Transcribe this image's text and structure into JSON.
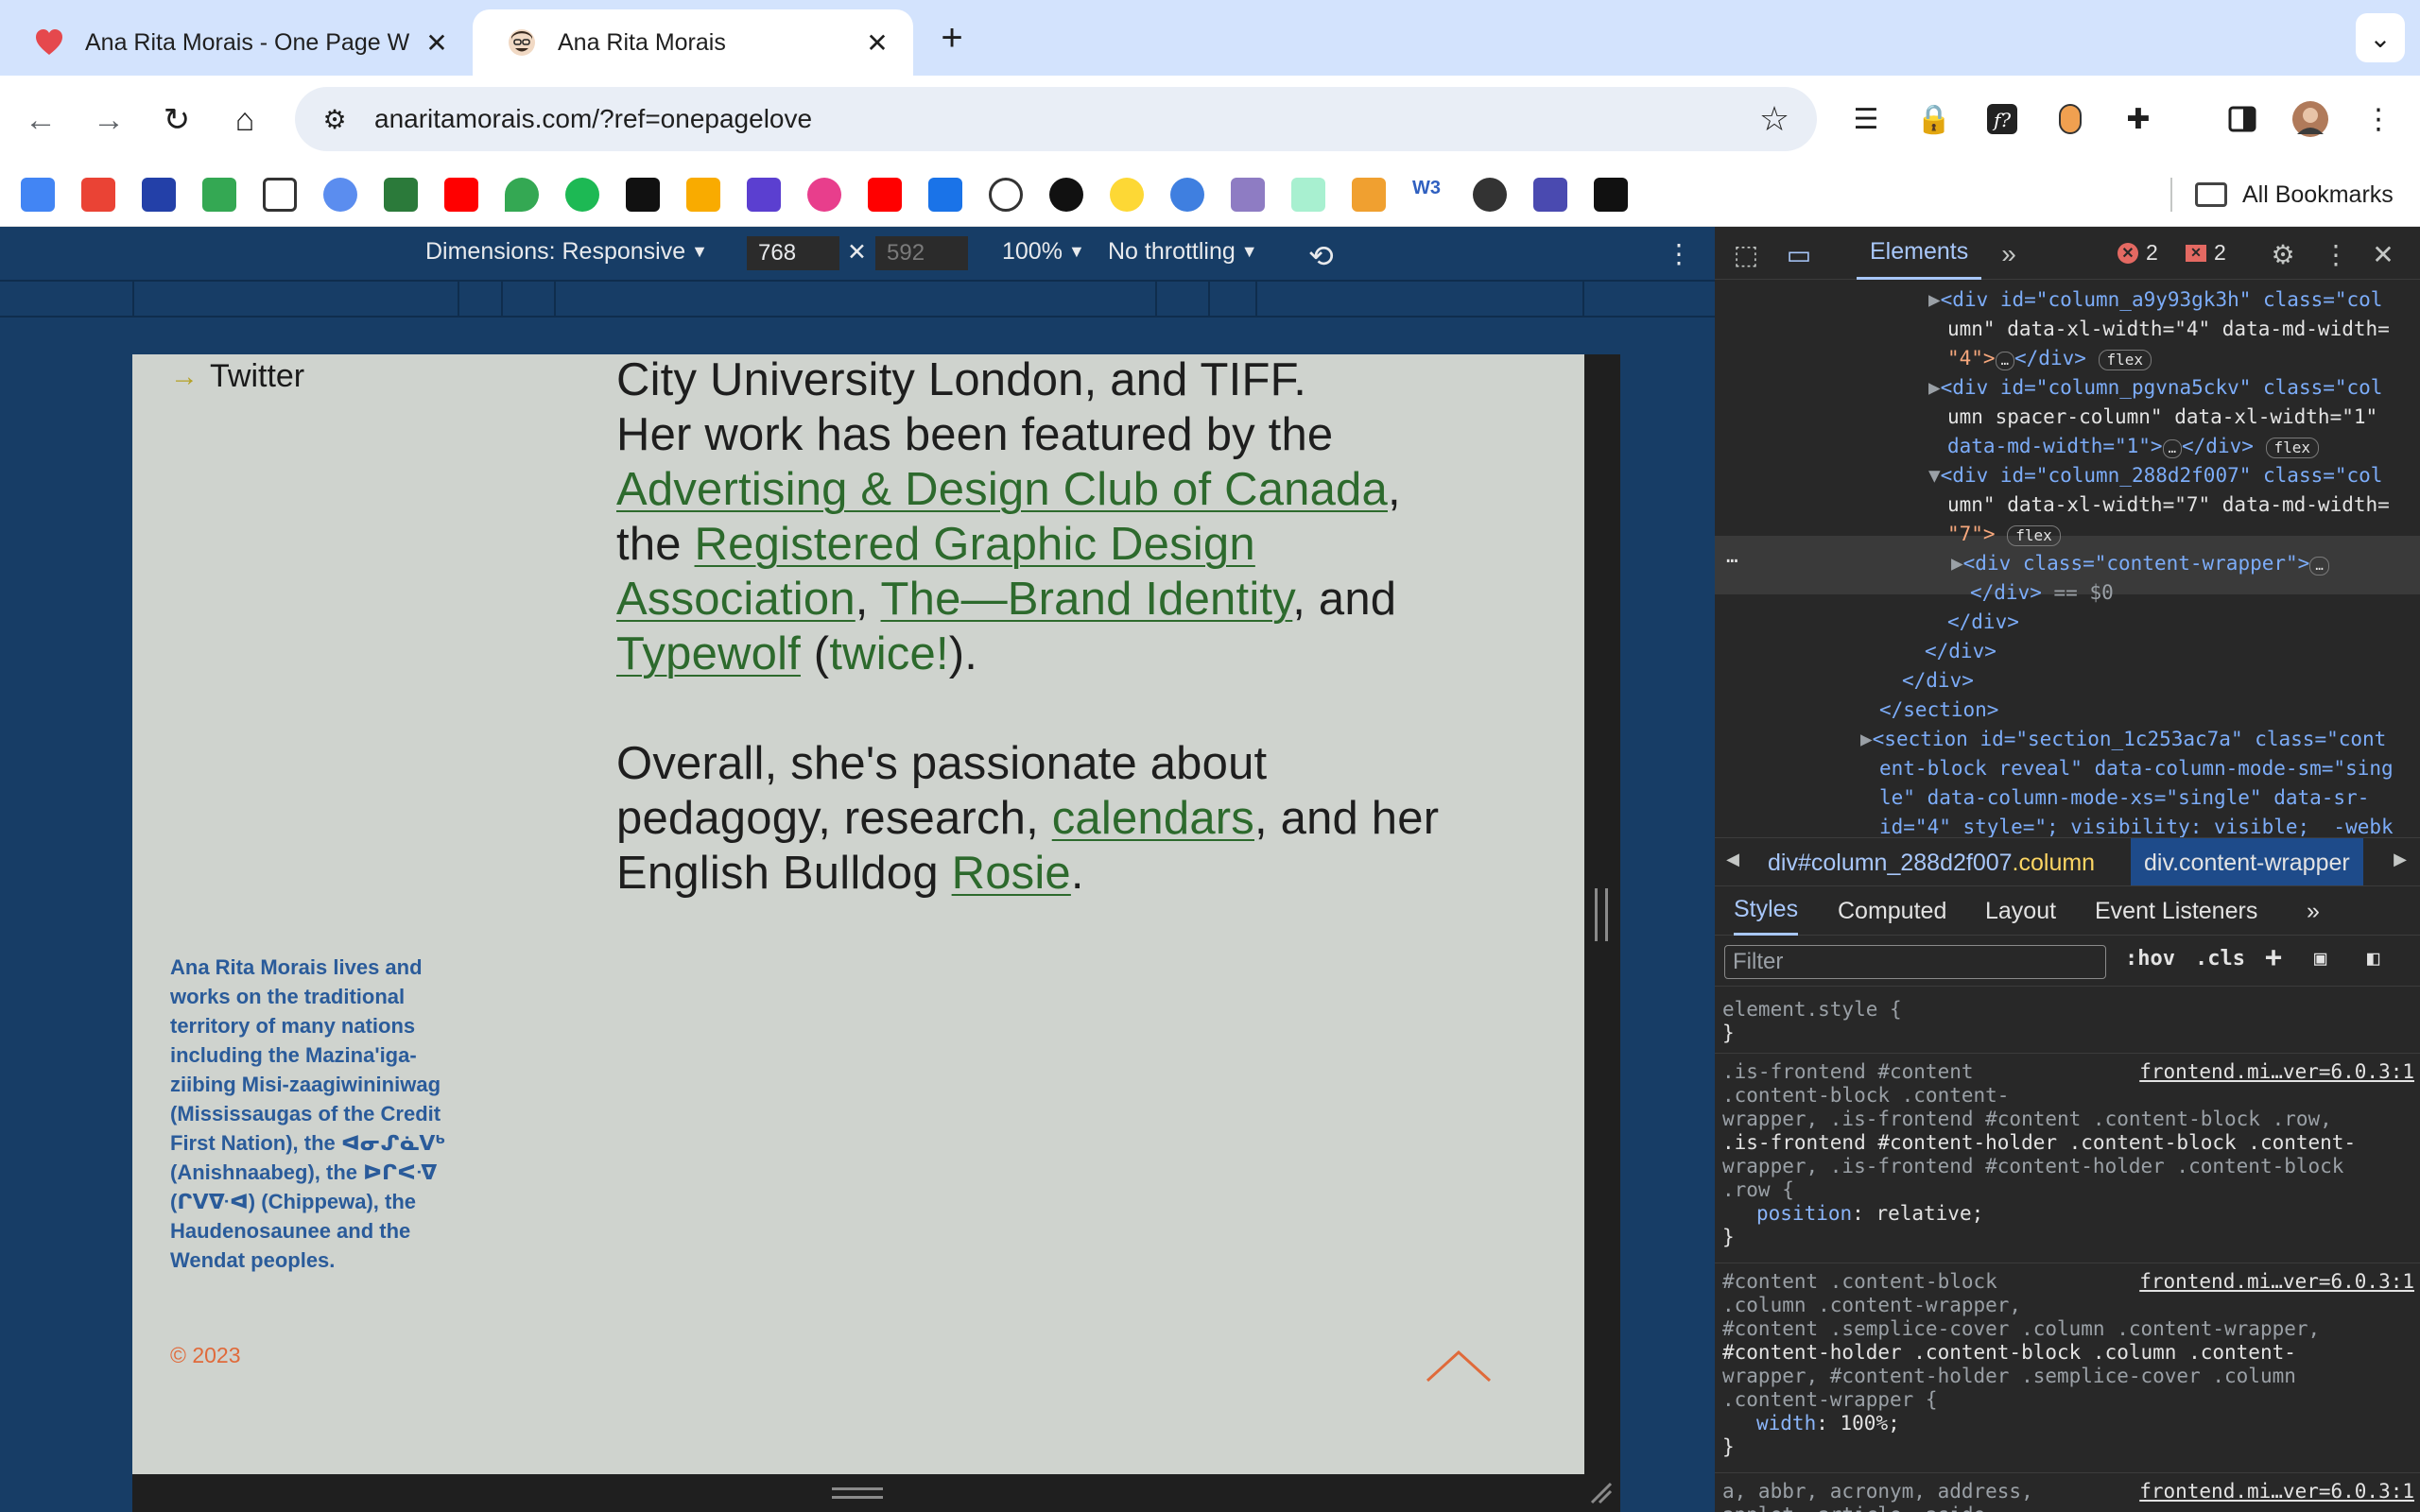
{
  "tabs": [
    {
      "title": "Ana Rita Morais - One Page W",
      "icon": "heart-icon"
    },
    {
      "title": "Ana Rita Morais",
      "icon": "avatar-icon"
    }
  ],
  "address": {
    "url": "anaritamorais.com/?ref=onepagelove"
  },
  "bookmarks": {
    "all_label": "All Bookmarks"
  },
  "device_toolbar": {
    "dimensions_label": "Dimensions: Responsive",
    "width": "768",
    "height": "592",
    "zoom": "100%",
    "throttling": "No throttling"
  },
  "page": {
    "nav_link": "Twitter",
    "bio_line1": "City University London, and TIFF.",
    "bio_line2": "Her work has been featured by the",
    "link_adcc": "Advertising & Design Club of Canada",
    "text_the": ", the ",
    "link_rgd": "Registered Graphic Design Association",
    "text_comma": ", ",
    "link_brand": "The—Brand Identity",
    "text_and": ", and ",
    "link_typewolf": "Typewolf",
    "text_twice_open": " (",
    "text_twice": "twice!",
    "text_twice_close": ").",
    "para2_start": "Overall, she's passionate about pedagogy, research, ",
    "link_calendars": "calendars",
    "para2_mid": ", and her English Bulldog ",
    "link_rosie": "Rosie",
    "para2_end": ".",
    "land_acknowledgement": "Ana Rita Morais lives and works on the traditional territory of many nations including the Mazina'iga-ziibing Misi-zaagiwininiwag (Mississaugas of the Credit First Nation), the ᐊᓂᔑᓈᐯᒃ (Anishnaabeg), the ᐅᒋᐸᐌ (ᒋᐯᐍᐊ) (Chippewa), the Haudenosaunee and the Wendat peoples.",
    "copyright": "© 2023"
  },
  "devtools": {
    "tab_elements": "Elements",
    "errors": "2",
    "warnings": "2",
    "dom": {
      "l1a": "<div id=\"column_a9y93gk3h\" class=\"col",
      "l1b": "umn\" data-xl-width=\"4\" data-md-width=",
      "l1c": "\"4\">",
      "l1d": "</div>",
      "l2a": "<div id=\"column_pgvna5ckv\" class=\"col",
      "l2b": "umn spacer-column\" data-xl-width=\"1\"",
      "l2c": "data-md-width=\"1\">",
      "l2d": "</div>",
      "l3a": "<div id=\"column_288d2f007\" class=\"col",
      "l3b": "umn\" data-xl-width=\"7\" data-md-width=",
      "l3c": "\"7\">",
      "l4a": "<div class=\"content-wrapper\">",
      "l4b": "</div>",
      "l4c": "== $0",
      "close1": "</div>",
      "close2": "</div>",
      "close3": "</div>",
      "close_section": "</section>",
      "s1": "<section id=\"section_1c253ac7a\" class=\"cont",
      "s2": "ent-block reveal\" data-column-mode-sm=\"sing",
      "s3": "le\" data-column-mode-xs=\"single\" data-sr-",
      "s4": "id=\"4\" style=\"; visibility: visible;  -webk",
      "flex": "flex"
    },
    "breadcrumb_1_tag": "div",
    "breadcrumb_1_id": "#column_288d2f007",
    "breadcrumb_1_class": ".column",
    "breadcrumb_2": "div.content-wrapper",
    "styles_tabs": [
      "Styles",
      "Computed",
      "Layout",
      "Event Listeners"
    ],
    "filter_placeholder": "Filter",
    "hov": ":hov",
    "cls": ".cls",
    "rule0_sel": "element.style {",
    "rule0_close": "}",
    "rule1_src": "frontend.mi…ver=6.0.3:1",
    "rule1_l1": ".is-frontend #content",
    "rule1_l2": ".content-block .content-",
    "rule1_l3": "wrapper, .is-frontend #content .content-block .row,",
    "rule1_l4": ".is-frontend #content-holder .content-block .content-",
    "rule1_l5": "wrapper, .is-frontend #content-holder .content-block",
    "rule1_l6": ".row {",
    "rule1_prop": "position",
    "rule1_val": "relative;",
    "rule1_close": "}",
    "rule2_src": "frontend.mi…ver=6.0.3:1",
    "rule2_l1": "#content .content-block",
    "rule2_l2": ".column .content-wrapper,",
    "rule2_l3": "#content .semplice-cover .column .content-wrapper,",
    "rule2_l4": "#content-holder .content-block .column .content-",
    "rule2_l5": "wrapper, #content-holder .semplice-cover .column",
    "rule2_l6": ".content-wrapper {",
    "rule2_prop": "width",
    "rule2_val": "100%;",
    "rule2_close": "}",
    "rule3_src": "frontend.mi…ver=6.0.3:1",
    "rule3_l1": "a, abbr, acronym, address,",
    "rule3_l2": "applet, article, aside,"
  },
  "colors": {
    "page_bg": "#cfd3ce",
    "link_green": "#2d6a2d",
    "land_blue": "#2a5b9a",
    "copyright_orange": "#e06a3a",
    "viewport_blue": "#173d66"
  }
}
